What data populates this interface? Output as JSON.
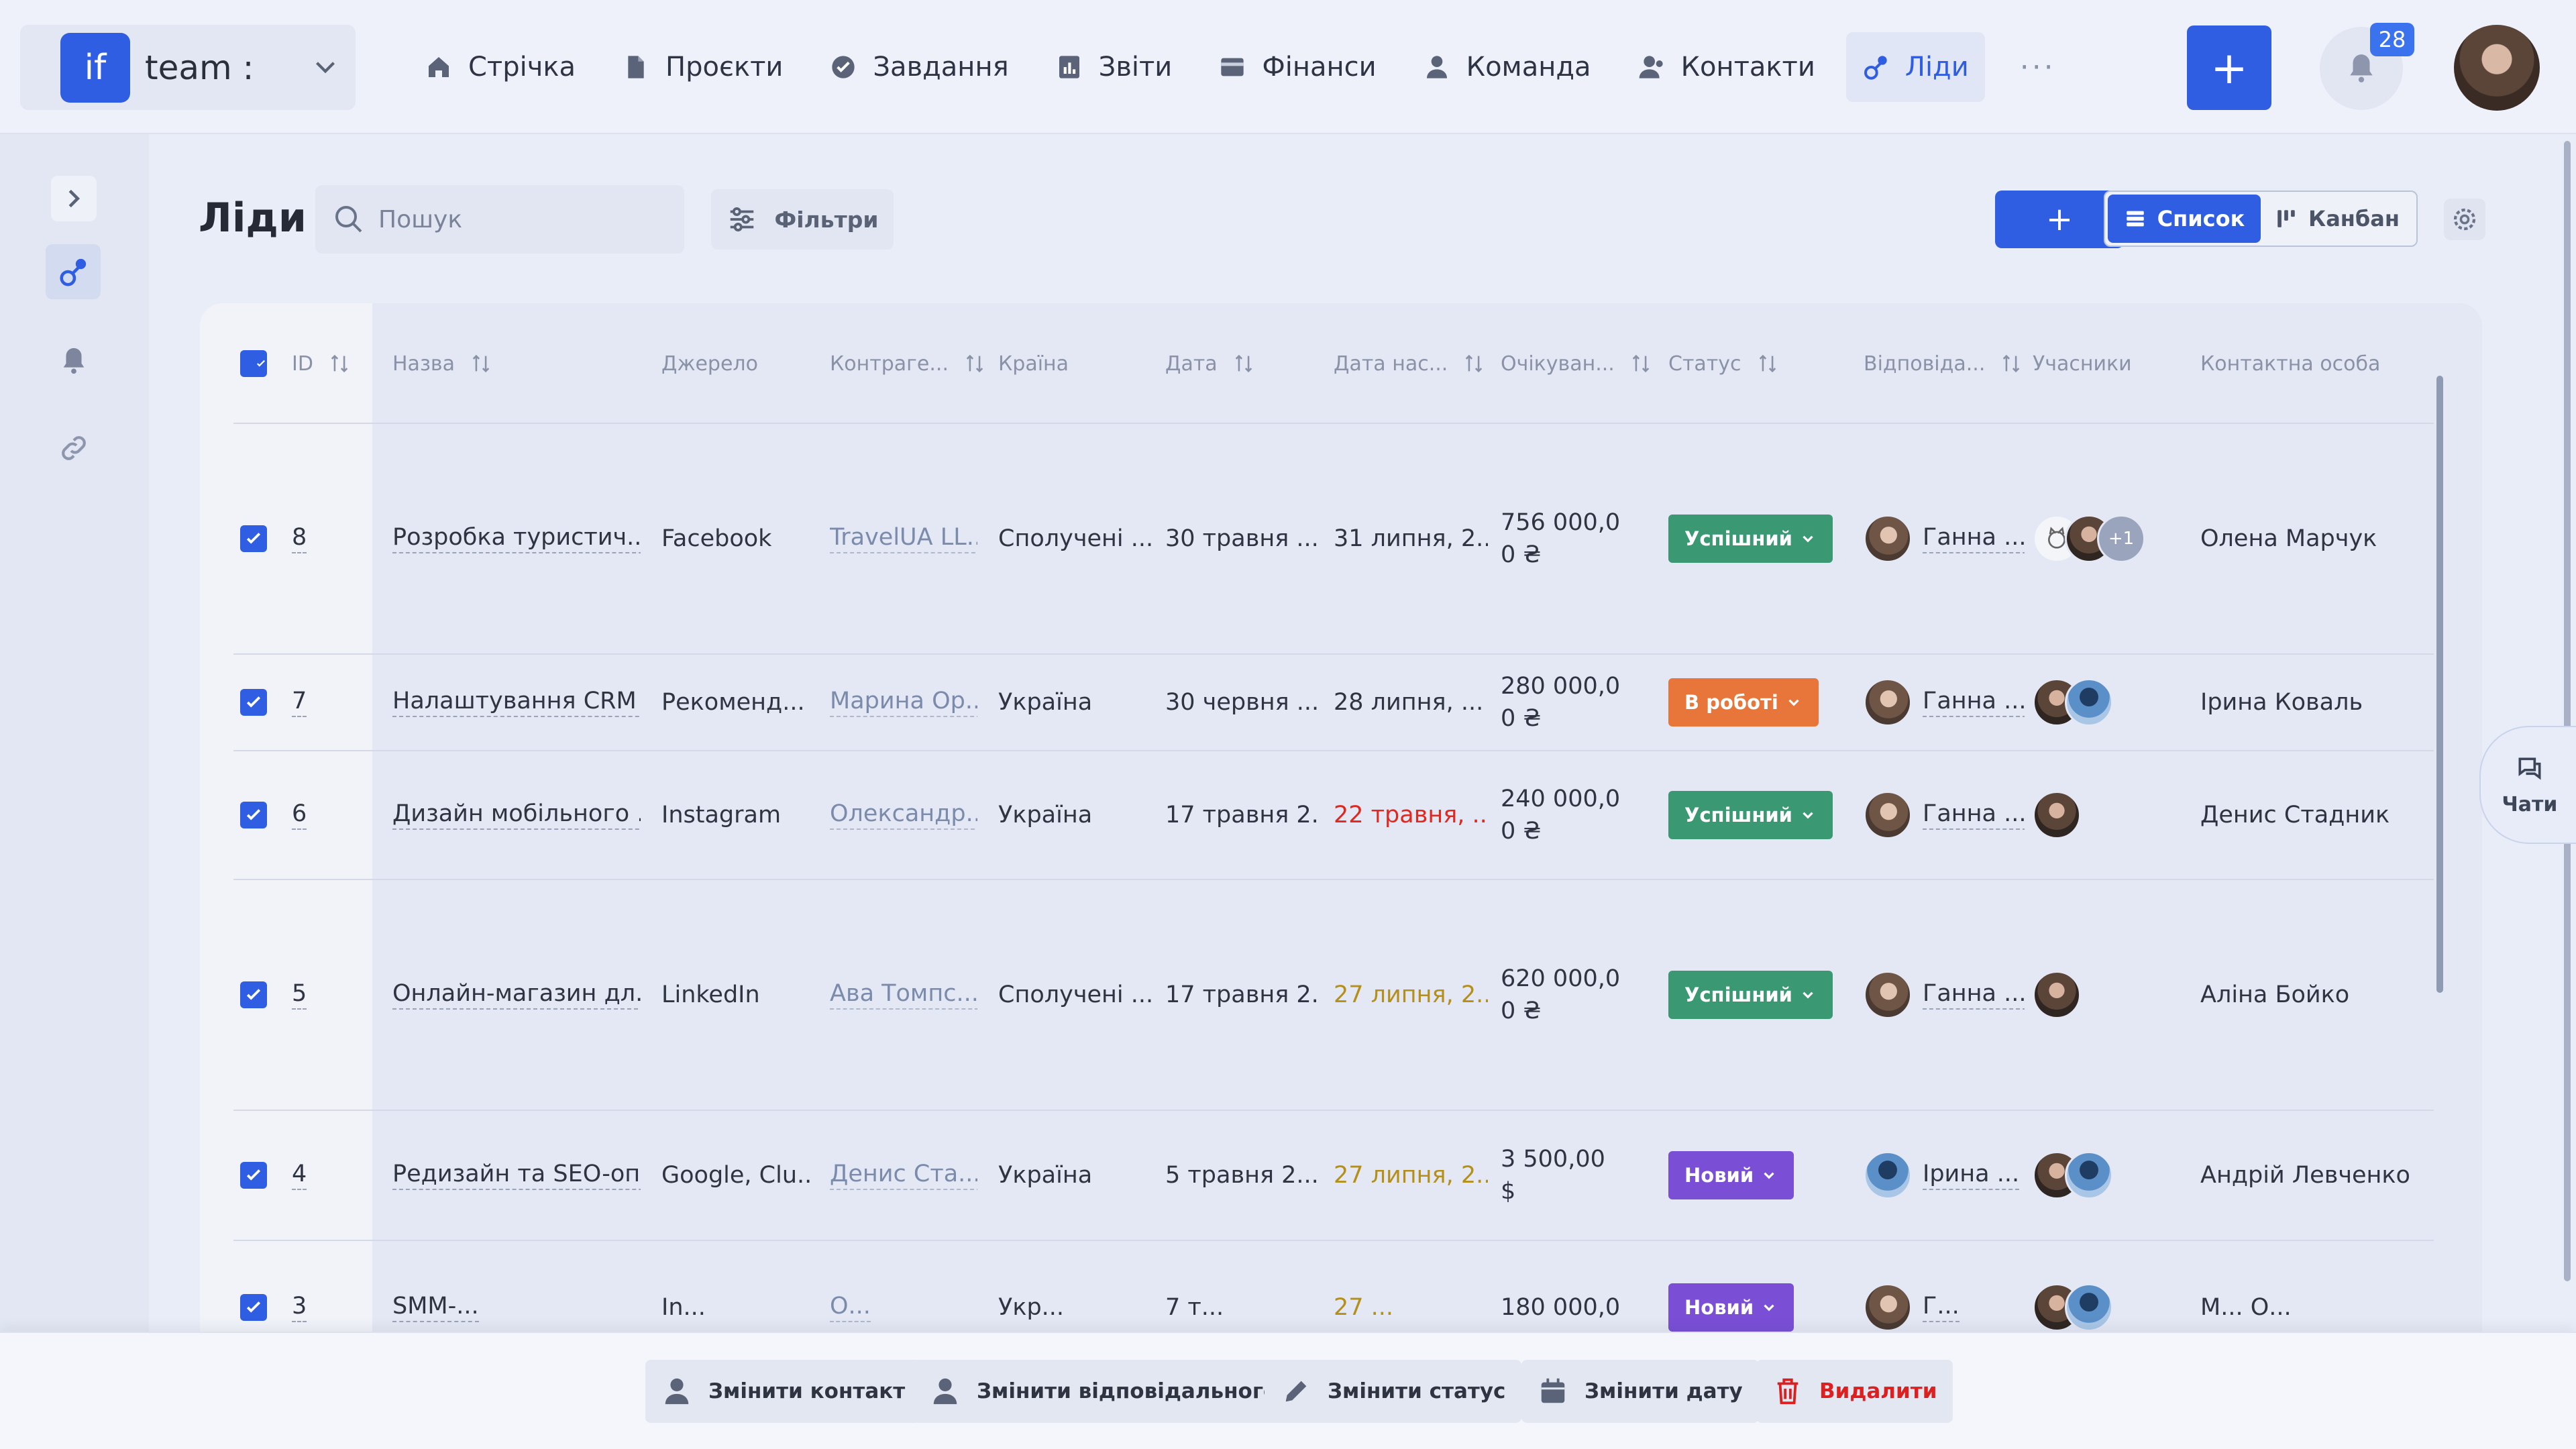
{
  "brand": {
    "logo": "if",
    "name": "team :"
  },
  "nav": {
    "items": [
      {
        "label": "Стрічка",
        "icon": "home-icon"
      },
      {
        "label": "Проєкти",
        "icon": "document-icon"
      },
      {
        "label": "Завдання",
        "icon": "check-circle-icon"
      },
      {
        "label": "Звіти",
        "icon": "report-icon"
      },
      {
        "label": "Фінанси",
        "icon": "wallet-icon"
      },
      {
        "label": "Команда",
        "icon": "user-icon"
      },
      {
        "label": "Контакти",
        "icon": "contacts-icon"
      },
      {
        "label": "Ліди",
        "icon": "leads-icon"
      }
    ],
    "active": "Ліди",
    "more": "···"
  },
  "topbar": {
    "add_label": "+",
    "notifications_count": "28"
  },
  "page": {
    "title": "Ліди",
    "search_placeholder": "Пошук",
    "filters_label": "Фільтри",
    "add_label": "+",
    "view_list": "Список",
    "view_kanban": "Канбан"
  },
  "table": {
    "headers": {
      "id": "ID",
      "name": "Назва",
      "source": "Джерело",
      "counterparty": "Контраге...",
      "country": "Країна",
      "date": "Дата",
      "next_date": "Дата нас...",
      "expected": "Очікуван...",
      "status": "Статус",
      "responsible": "Відповіда...",
      "members": "Учасники",
      "contact": "Контактна особа"
    },
    "rows": [
      {
        "id": "8",
        "name": "Розробка туристич...",
        "source": "Facebook",
        "counterparty": "TravelUA LL...",
        "country": "Сполучені ...",
        "date": "30 травня ...",
        "next_date": "31 липня, 2...",
        "next_date_color": "normal",
        "expected": "756 000,0 0 ₴",
        "status": "Успішний",
        "status_color": "#3a9873",
        "responsible": "Ганна ...",
        "members": [
          "cat",
          "w2",
          "+1"
        ],
        "contact": "Олена Марчук"
      },
      {
        "id": "7",
        "name": "Налаштування CRM ...",
        "source": "Рекоменд...",
        "counterparty": "Марина Ор...",
        "country": "Україна",
        "date": "30 червня ...",
        "next_date": "28 липня, ...",
        "next_date_color": "normal",
        "expected": "280 000,0 0 ₴",
        "status": "В роботі",
        "status_color": "#e8753a",
        "responsible": "Ганна ...",
        "members": [
          "w2",
          "m1"
        ],
        "contact": "Ірина Коваль"
      },
      {
        "id": "6",
        "name": "Дизайн мобільного ...",
        "source": "Instagram",
        "counterparty": "Олександр...",
        "country": "Україна",
        "date": "17 травня 2...",
        "next_date": "22 травня, ...",
        "next_date_color": "red",
        "expected": "240 000,0 0 ₴",
        "status": "Успішний",
        "status_color": "#3a9873",
        "responsible": "Ганна ...",
        "members": [
          "w2"
        ],
        "contact": "Денис Стадник"
      },
      {
        "id": "5",
        "name": "Онлайн-магазин дл...",
        "source": "LinkedIn",
        "counterparty": "Ава Томпс...",
        "country": "Сполучені ...",
        "date": "17 травня 2...",
        "next_date": "27 липня, 2...",
        "next_date_color": "olive",
        "expected": "620 000,0 0 ₴",
        "status": "Успішний",
        "status_color": "#3a9873",
        "responsible": "Ганна ...",
        "members": [
          "w2"
        ],
        "contact": "Аліна Бойко"
      },
      {
        "id": "4",
        "name": "Редизайн та SEO-оп...",
        "source": "Google, Clu...",
        "counterparty": "Денис Ста...",
        "country": "Україна",
        "date": "5 травня 2...",
        "next_date": "27 липня, 2...",
        "next_date_color": "olive",
        "expected": "3 500,00 $",
        "status": "Новий",
        "status_color": "#7a4fd6",
        "responsible": "Ірина ...",
        "members": [
          "w2",
          "m1"
        ],
        "contact": "Андрій Левченко"
      },
      {
        "id": "3",
        "name": "SMM-...",
        "source": "In...",
        "counterparty": "О...",
        "country": "Укр...",
        "date": "7 т...",
        "next_date": "27 ...",
        "next_date_color": "olive",
        "expected": "180 000,0",
        "status": "Новий",
        "status_color": "#7a4fd6",
        "responsible": "Г...",
        "members": [
          "w2",
          "m1"
        ],
        "contact": "М... О..."
      }
    ]
  },
  "chats_label": "Чати",
  "bulk_actions": [
    {
      "label": "Змінити контакт",
      "icon": "user-icon"
    },
    {
      "label": "Змінити відповідального",
      "icon": "user-icon"
    },
    {
      "label": "Змінити статус",
      "icon": "pencil-icon"
    },
    {
      "label": "Змінити дату",
      "icon": "calendar-icon"
    },
    {
      "label": "Видалити",
      "icon": "trash-icon",
      "danger": true
    }
  ]
}
